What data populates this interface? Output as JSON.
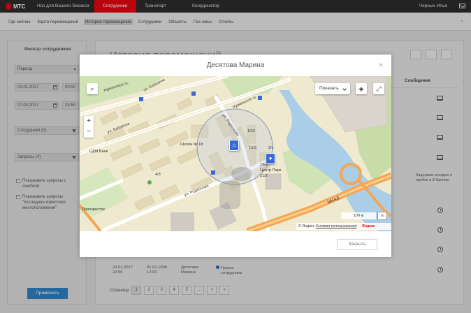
{
  "header": {
    "logo": "МТС",
    "slogan": "Ноз для Вашего бизнеса",
    "nav": [
      "Сотрудники",
      "Транспорт",
      "Координатор"
    ],
    "user": "Черных Илья",
    "colors": {
      "brand": "#e30611",
      "topbar": "#2b2b2b"
    }
  },
  "subnav": {
    "tabs": [
      "Где сейчас",
      "Карта перемещений",
      "История перемещений",
      "Сотрудники",
      "Объекты",
      "Гео-зоны",
      "Отчеты"
    ],
    "active_index": 2
  },
  "sidebar": {
    "title": "Фильтр сотрудников",
    "period_label": "Период",
    "date_from": "01.01.2017",
    "time_from": "00:00",
    "date_to": "07.03.2017",
    "time_to": "23:59",
    "employees": "Сотрудники (0)",
    "requests": "Запросы (4)",
    "checkbox1": "Показывать запросы с ошибкой",
    "checkbox2": "Показывать запросы \"последнее известное местоположение\"",
    "apply": "Применить"
  },
  "main": {
    "page_title": "История перемещений",
    "column_message": "Сообщение",
    "delay_text": "Задержка опоздал о пробке в 8 баллов.",
    "last_row": {
      "date": "23.01.2017",
      "time": "22:00",
      "date2": "01.01.1900",
      "time2": "12:00",
      "name1": "Десятова",
      "name2": "Марина",
      "group1": "Группа",
      "group2": "сотрудника"
    },
    "pager": {
      "label": "Страница",
      "pages": [
        "1",
        "2",
        "3",
        "4",
        "5",
        "...",
        ">",
        "»"
      ]
    }
  },
  "modal": {
    "title": "Десятова Марина",
    "close": "×",
    "show_button": "Показать",
    "zoom_in": "+",
    "zoom_out": "−",
    "scale": "100 м",
    "copyright_prefix": "© Яндекс",
    "copyright_link": "Условия использования",
    "yandex": "Яндекс",
    "footer_button": "Закрыть",
    "map_labels": {
      "street1": "Куркинское ш.",
      "street2": "ул. Бабакина",
      "street3": "Куркинское ш.",
      "street4": "ул. Родионова",
      "street5": "ул. Бабакина",
      "street6": "ул. Родионова",
      "street7": "МКАД",
      "school": "Школа № 18",
      "bank": "СДМ Банк",
      "crossroads": "Перекресток",
      "center": "Центр Парк",
      "house1": "16/2",
      "house2": "16/3",
      "house3": "2/1",
      "house4": "19/2",
      "house5": "21/2",
      "house6": "4/3"
    }
  }
}
